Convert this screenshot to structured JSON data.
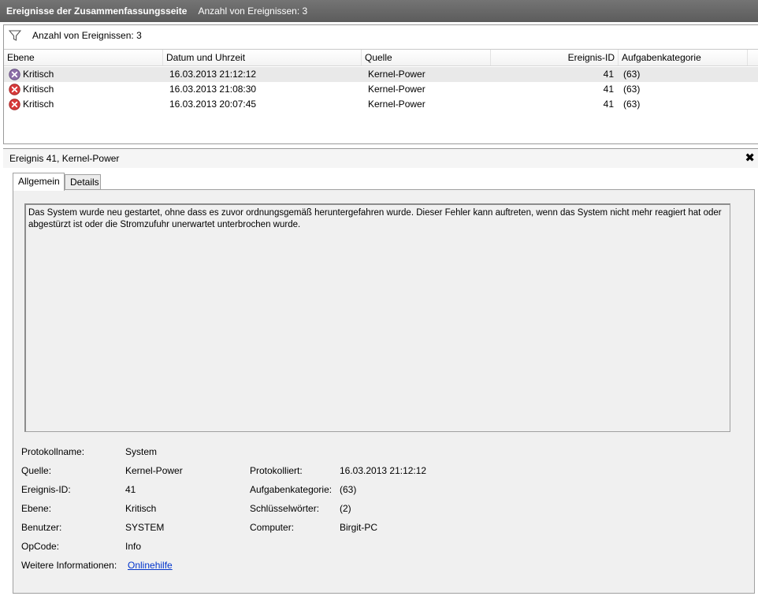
{
  "titlebar": {
    "title": "Ereignisse der Zusammenfassungsseite",
    "count": "Anzahl von Ereignissen: 3"
  },
  "filter": {
    "text": "Anzahl von Ereignissen: 3",
    "icon": "filter-icon"
  },
  "table": {
    "columns": [
      "Ebene",
      "Datum und Uhrzeit",
      "Quelle",
      "Ereignis-ID",
      "Aufgabenkategorie"
    ],
    "rows": [
      {
        "level": "Kritisch",
        "datetime": "16.03.2013 21:12:12",
        "source": "Kernel-Power",
        "id": "41",
        "category": "(63)"
      },
      {
        "level": "Kritisch",
        "datetime": "16.03.2013 21:08:30",
        "source": "Kernel-Power",
        "id": "41",
        "category": "(63)"
      },
      {
        "level": "Kritisch",
        "datetime": "16.03.2013 20:07:45",
        "source": "Kernel-Power",
        "id": "41",
        "category": "(63)"
      }
    ]
  },
  "detail": {
    "title": "Ereignis 41, Kernel-Power",
    "close": "✖",
    "tabs": [
      "Allgemein",
      "Details"
    ],
    "description": "Das System wurde neu gestartet, ohne dass es zuvor ordnungsgemäß heruntergefahren wurde. Dieser Fehler kann auftreten, wenn das System nicht mehr reagiert hat oder abgestürzt ist oder die Stromzufuhr unerwartet unterbrochen wurde.",
    "props": {
      "protokollname_label": "Protokollname:",
      "protokollname": "System",
      "quelle_label": "Quelle:",
      "quelle": "Kernel-Power",
      "protokolliert_label": "Protokolliert:",
      "protokolliert": "16.03.2013 21:12:12",
      "ereignisid_label": "Ereignis-ID:",
      "ereignisid": "41",
      "aufgabenkategorie_label": "Aufgabenkategorie:",
      "aufgabenkategorie": "(63)",
      "ebene_label": "Ebene:",
      "ebene": "Kritisch",
      "schluessel_label": "Schlüsselwörter:",
      "schluessel": "(2)",
      "benutzer_label": "Benutzer:",
      "benutzer": "SYSTEM",
      "computer_label": "Computer:",
      "computer": "Birgit-PC",
      "opcode_label": "OpCode:",
      "opcode": "Info",
      "weitere_label": "Weitere Informationen:",
      "weitere_link": "Onlinehilfe"
    }
  },
  "colors": {
    "titlebar": "#5c5c5c",
    "error_icon": "#d83a3a",
    "link": "#0033cc"
  }
}
